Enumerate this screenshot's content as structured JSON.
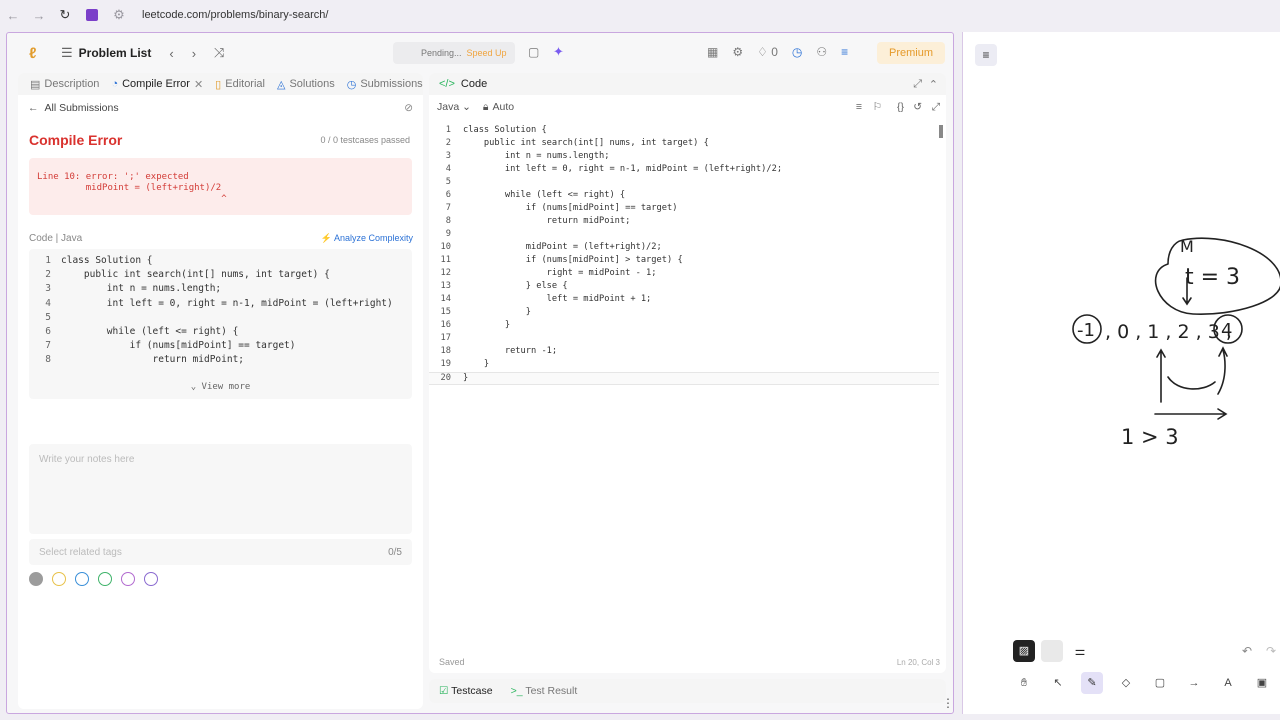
{
  "browser": {
    "url": "leetcode.com/problems/binary-search/"
  },
  "topbar": {
    "problem_list": "Problem List",
    "pending": "Pending...",
    "speed_up": "Speed Up",
    "streak": "0",
    "premium": "Premium"
  },
  "left": {
    "tabs": [
      "Description",
      "Compile Error",
      "Editorial",
      "Solutions",
      "Submissions"
    ],
    "all_submissions": "All Submissions",
    "title": "Compile Error",
    "passed": "0 / 0  testcases passed",
    "error_text": "Line 10: error: ';' expected\n         midPoint = (left+right)/2\n                                  ^",
    "code_label": "Code  |  Java",
    "analyze": "Analyze Complexity",
    "code_lines": [
      "class Solution {",
      "    public int search(int[] nums, int target) {",
      "        int n = nums.length;",
      "        int left = 0, right = n-1, midPoint = (left+right)",
      "",
      "        while (left <= right) {",
      "            if (nums[midPoint] == target)",
      "                return midPoint;"
    ],
    "view_more": "View more",
    "notes_placeholder": "Write your notes here",
    "tags_placeholder": "Select related tags",
    "tags_count": "0/5"
  },
  "editor": {
    "title": "Code",
    "language": "Java",
    "mode": "Auto",
    "lines": [
      "class Solution {",
      "    public int search(int[] nums, int target) {",
      "        int n = nums.length;",
      "        int left = 0, right = n-1, midPoint = (left+right)/2;",
      "",
      "        while (left <= right) {",
      "            if (nums[midPoint] == target)",
      "                return midPoint;",
      "",
      "            midPoint = (left+right)/2;",
      "            if (nums[midPoint] > target) {",
      "                right = midPoint - 1;",
      "            } else {",
      "                left = midPoint + 1;",
      "            }",
      "        }",
      "",
      "        return -1;",
      "    }",
      "}"
    ],
    "saved": "Saved",
    "position": "Ln 20, Col 3"
  },
  "bottom": {
    "testcase": "Testcase",
    "test_result": "Test Result"
  },
  "whiteboard": {
    "sketch_text": [
      "M",
      "t = 3",
      "-1",
      ", 0 , 1 , 2 , 3 ,",
      "4",
      "1 > 3"
    ]
  },
  "colors": {
    "error_red": "#d9322e",
    "premium_orange": "#e59a2a",
    "link_blue": "#2c72d6",
    "accent_green": "#2bb55e"
  }
}
